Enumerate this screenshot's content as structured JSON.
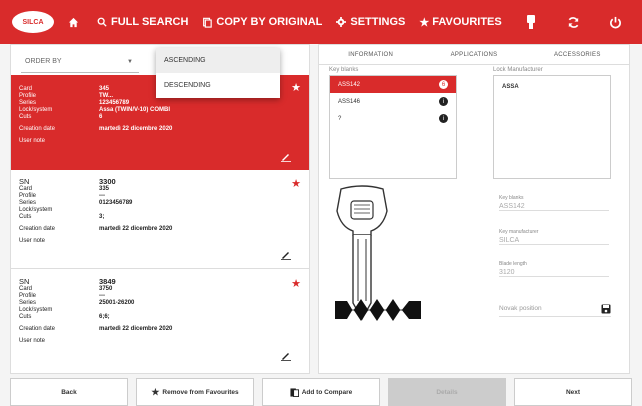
{
  "topbar": {
    "logo_text": "SILCA",
    "items": [
      {
        "label": "FULL SEARCH"
      },
      {
        "label": "COPY BY ORIGINAL"
      },
      {
        "label": "SETTINGS"
      },
      {
        "label": "FAVOURITES"
      }
    ]
  },
  "order": {
    "label": "ORDER BY",
    "options": [
      "ASCENDING",
      "DESCENDING"
    ]
  },
  "cards": [
    {
      "rows": [
        {
          "k": "Card",
          "v": "345"
        },
        {
          "k": "Profile",
          "v": "TW..."
        },
        {
          "k": "Series",
          "v": "123456789"
        },
        {
          "k": "Lock/system",
          "v": "Assa (TWIN/V-10) COMBI"
        },
        {
          "k": "Cuts",
          "v": "6"
        }
      ],
      "date_label": "Creation date",
      "date": "martedì 22 dicembre 2020",
      "note_label": "User note"
    },
    {
      "sn_label": "SN",
      "sn": "3300",
      "rows": [
        {
          "k": "Card",
          "v": "335"
        },
        {
          "k": "Profile",
          "v": "---"
        },
        {
          "k": "Series",
          "v": "0123456789"
        },
        {
          "k": "Lock/system",
          "v": ""
        },
        {
          "k": "Cuts",
          "v": "3;"
        }
      ],
      "date_label": "Creation date",
      "date": "martedì 22 dicembre 2020",
      "note_label": "User note"
    },
    {
      "sn_label": "SN",
      "sn": "3849",
      "rows": [
        {
          "k": "Card",
          "v": "3750"
        },
        {
          "k": "Profile",
          "v": "---"
        },
        {
          "k": "Series",
          "v": "25001-26200"
        },
        {
          "k": "Lock/system",
          "v": ""
        },
        {
          "k": "Cuts",
          "v": "6;6;"
        }
      ],
      "date_label": "Creation date",
      "date": "martedì 22 dicembre 2020",
      "note_label": "User note"
    }
  ],
  "tabs": [
    "INFORMATION",
    "APPLICATIONS",
    "ACCESSORIES"
  ],
  "key_blanks": {
    "label": "Key blanks",
    "items": [
      {
        "name": "ASS142",
        "badge": "6"
      },
      {
        "name": "ASS146",
        "badge": "i"
      },
      {
        "name": "?",
        "badge": "i"
      }
    ]
  },
  "lock_manufacturer": {
    "label": "Lock Manufacturer",
    "value": "ASSA"
  },
  "fields": [
    {
      "label": "Key blanks",
      "value": "ASS142"
    },
    {
      "label": "Key manufacturer",
      "value": "SILCA"
    },
    {
      "label": "Blade length",
      "value": "3120"
    }
  ],
  "note_placeholder": "Novak position",
  "bottom": {
    "back": "Back",
    "remove_fav": "Remove from Favourites",
    "add_compare": "Add to Compare",
    "disabled": "Details",
    "next": "Next"
  },
  "colors": {
    "accent": "#d92b2b"
  }
}
